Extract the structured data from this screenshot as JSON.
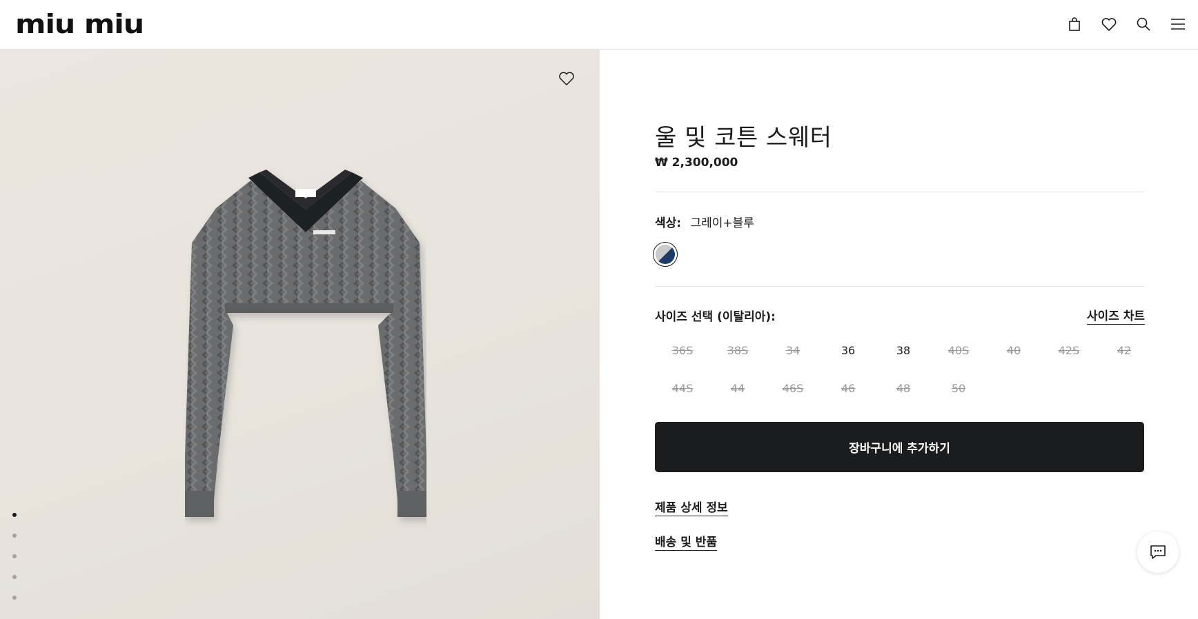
{
  "header": {
    "brand": "miu miu",
    "icons": [
      "shopping-bag-icon",
      "heart-icon",
      "search-icon",
      "menu-icon"
    ]
  },
  "gallery": {
    "image": "grey cropped cable-knit V-neck sweater with black collar",
    "slide_count": 5,
    "active_slide": 1
  },
  "product": {
    "title": "울 및 코튼 스웨터",
    "price": "₩ 2,300,000",
    "color_label": "색상:",
    "color_value": "그레이+블루",
    "swatch_colors": [
      "#c9cacc",
      "#1d3c6a"
    ],
    "size_label": "사이즈 선택 (이탈리아):",
    "size_chart": "사이즈 차트",
    "sizes": [
      {
        "label": "36S",
        "available": false
      },
      {
        "label": "38S",
        "available": false
      },
      {
        "label": "34",
        "available": false
      },
      {
        "label": "36",
        "available": true
      },
      {
        "label": "38",
        "available": true
      },
      {
        "label": "40S",
        "available": false
      },
      {
        "label": "40",
        "available": false
      },
      {
        "label": "42S",
        "available": false
      },
      {
        "label": "42",
        "available": false
      },
      {
        "label": "44S",
        "available": false
      },
      {
        "label": "44",
        "available": false
      },
      {
        "label": "46S",
        "available": false
      },
      {
        "label": "46",
        "available": false
      },
      {
        "label": "48",
        "available": false
      },
      {
        "label": "50",
        "available": false
      }
    ],
    "add_to_cart": "장바구니에 추가하기",
    "details_link": "제품 상세 정보",
    "shipping_link": "배송 및 반품"
  },
  "colors": {
    "text": "#1b1b1b",
    "button_bg": "#1b1c1e",
    "unavailable": "#9a9a9a",
    "gallery_bg": "#e8e4dd"
  }
}
